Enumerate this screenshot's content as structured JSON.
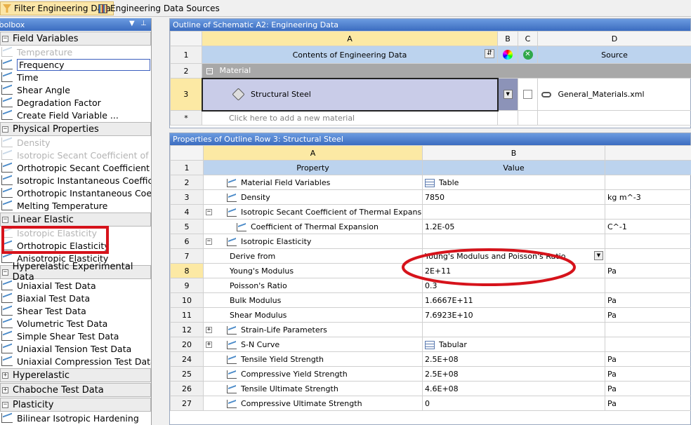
{
  "tabs": {
    "filter": "Filter Engineering Data",
    "sources": "Engineering Data Sources"
  },
  "toolbox": {
    "title": "Toolbox",
    "groups": [
      {
        "label": "Field Variables",
        "items": [
          {
            "label": "Temperature",
            "disabled": true
          },
          {
            "label": "Frequency",
            "selected": true
          },
          {
            "label": "Time"
          },
          {
            "label": "Shear Angle"
          },
          {
            "label": "Degradation Factor"
          },
          {
            "label": "Create Field Variable ..."
          }
        ]
      },
      {
        "label": "Physical Properties",
        "items": [
          {
            "label": "Density",
            "disabled": true
          },
          {
            "label": "Isotropic Secant Coefficient of Thermal Expansion",
            "disabled": true
          },
          {
            "label": "Orthotropic Secant Coefficient of Thermal Expansion"
          },
          {
            "label": "Isotropic Instantaneous Coefficient of Thermal Expansion"
          },
          {
            "label": "Orthotropic Instantaneous Coefficient of Thermal Expansion"
          },
          {
            "label": "Melting Temperature"
          }
        ]
      },
      {
        "label": "Linear Elastic",
        "items": [
          {
            "label": "Isotropic Elasticity",
            "disabled": true
          },
          {
            "label": "Orthotropic Elasticity"
          },
          {
            "label": "Anisotropic Elasticity"
          }
        ]
      },
      {
        "label": "Hyperelastic Experimental Data",
        "items": [
          {
            "label": "Uniaxial Test Data"
          },
          {
            "label": "Biaxial Test Data"
          },
          {
            "label": "Shear Test Data"
          },
          {
            "label": "Volumetric Test Data"
          },
          {
            "label": "Simple Shear Test Data"
          },
          {
            "label": "Uniaxial Tension Test Data"
          },
          {
            "label": "Uniaxial Compression Test Data"
          }
        ]
      },
      {
        "label": "Hyperelastic",
        "items": []
      },
      {
        "label": "Chaboche Test Data",
        "items": []
      },
      {
        "label": "Plasticity",
        "items": [
          {
            "label": "Bilinear Isotropic Hardening"
          }
        ]
      }
    ]
  },
  "outline": {
    "title": "Outline of Schematic A2: Engineering Data",
    "cols": [
      "A",
      "B",
      "C",
      "D"
    ],
    "header": {
      "contents": "Contents of Engineering Data",
      "source": "Source"
    },
    "rows": [
      "1",
      "2",
      "3",
      "*"
    ],
    "material_label": "Material",
    "material_name": "Structural Steel",
    "material_source": "General_Materials.xml",
    "add_placeholder": "Click here to add a new material"
  },
  "properties": {
    "title": "Properties of Outline Row 3: Structural Steel",
    "cols": [
      "A",
      "B"
    ],
    "header": {
      "property": "Property",
      "value": "Value"
    },
    "rows": [
      {
        "n": "1",
        "header": true
      },
      {
        "n": "2",
        "indent": 1,
        "icon": "chart",
        "name": "Material Field Variables",
        "value": "Table",
        "vicon": "table",
        "unit": ""
      },
      {
        "n": "3",
        "indent": 1,
        "icon": "chart",
        "name": "Density",
        "value": "7850",
        "unit": "kg m^-3"
      },
      {
        "n": "4",
        "indent": 1,
        "pm": "−",
        "icon": "chart",
        "name": "Isotropic Secant Coefficient of Thermal Expansion",
        "value": "",
        "unit": ""
      },
      {
        "n": "5",
        "indent": 2,
        "icon": "chart",
        "name": "Coefficient of Thermal Expansion",
        "value": "1.2E-05",
        "unit": "C^-1"
      },
      {
        "n": "6",
        "indent": 1,
        "pm": "−",
        "icon": "chart",
        "name": "Isotropic Elasticity",
        "value": "",
        "unit": ""
      },
      {
        "n": "7",
        "indent": 0,
        "name": "Derive from",
        "value": "Young's Modulus and Poisson's Ratio",
        "dropdown": true,
        "unit": ""
      },
      {
        "n": "8",
        "indent": 0,
        "name": "Young's Modulus",
        "value": "2E+11",
        "unit": "Pa",
        "selected": true
      },
      {
        "n": "9",
        "indent": 0,
        "name": "Poisson's Ratio",
        "value": "0.3",
        "unit": ""
      },
      {
        "n": "10",
        "indent": 0,
        "name": "Bulk Modulus",
        "value": "1.6667E+11",
        "unit": "Pa"
      },
      {
        "n": "11",
        "indent": 0,
        "name": "Shear Modulus",
        "value": "7.6923E+10",
        "unit": "Pa"
      },
      {
        "n": "12",
        "indent": 1,
        "pm": "+",
        "icon": "chart",
        "name": "Strain-Life Parameters",
        "value": "",
        "unit": ""
      },
      {
        "n": "20",
        "indent": 1,
        "pm": "+",
        "icon": "chart",
        "name": "S-N Curve",
        "value": "Tabular",
        "vicon": "table",
        "unit": ""
      },
      {
        "n": "24",
        "indent": 1,
        "icon": "chart",
        "name": "Tensile Yield Strength",
        "value": "2.5E+08",
        "unit": "Pa"
      },
      {
        "n": "25",
        "indent": 1,
        "icon": "chart",
        "name": "Compressive Yield Strength",
        "value": "2.5E+08",
        "unit": "Pa"
      },
      {
        "n": "26",
        "indent": 1,
        "icon": "chart",
        "name": "Tensile Ultimate Strength",
        "value": "4.6E+08",
        "unit": "Pa"
      },
      {
        "n": "27",
        "indent": 1,
        "icon": "chart",
        "name": "Compressive Ultimate Strength",
        "value": "0",
        "unit": "Pa"
      }
    ]
  },
  "colors": {
    "highlight_red": "#d6131b",
    "title_blue": "#4a7fd0",
    "selected_yellow": "#fce9a4"
  }
}
